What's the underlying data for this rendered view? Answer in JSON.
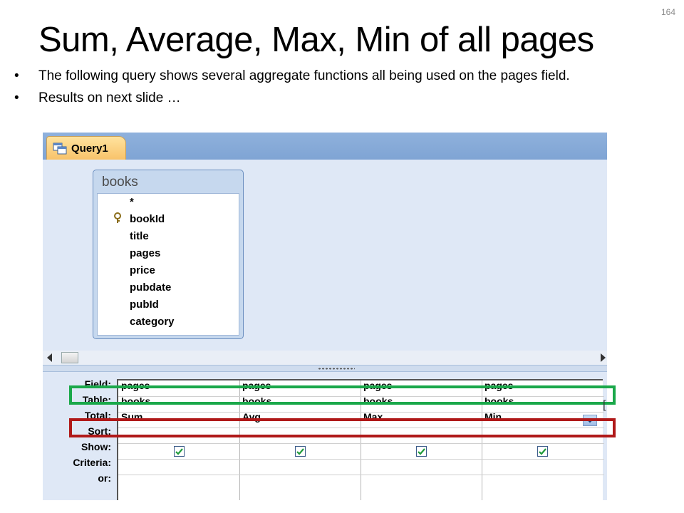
{
  "slide": {
    "number": "164",
    "title": "Sum, Average, Max, Min of all pages",
    "bullets": [
      "The following query shows several aggregate functions all being used on the pages field.",
      "Results on next slide …"
    ]
  },
  "window": {
    "tab_label": "Query1"
  },
  "table": {
    "name": "books",
    "fields": [
      "*",
      "bookId",
      "title",
      "pages",
      "price",
      "pubdate",
      "pubId",
      "category"
    ],
    "primary_key": "bookId"
  },
  "grid": {
    "row_labels": [
      "Field:",
      "Table:",
      "Total:",
      "Sort:",
      "Show:",
      "Criteria:",
      "or:"
    ],
    "columns": [
      {
        "field": "pages",
        "table": "books",
        "total": "Sum",
        "show": true
      },
      {
        "field": "pages",
        "table": "books",
        "total": "Avg",
        "show": true
      },
      {
        "field": "pages",
        "table": "books",
        "total": "Max",
        "show": true
      },
      {
        "field": "pages",
        "table": "books",
        "total": "Min",
        "show": true
      }
    ]
  },
  "colors": {
    "field_highlight": "#1aa84a",
    "total_highlight": "#b01919"
  }
}
